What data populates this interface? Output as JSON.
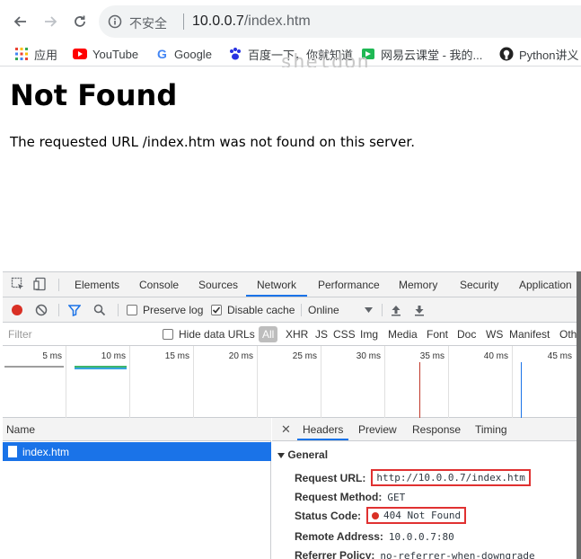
{
  "browser": {
    "omnibox": {
      "security_label": "不安全",
      "host": "10.0.0.7",
      "path": "/index.htm"
    },
    "bookmarks": [
      {
        "label": "应用"
      },
      {
        "label": "YouTube"
      },
      {
        "label": "Google"
      },
      {
        "label": "百度一下，你就知道"
      },
      {
        "label": "网易云课堂 - 我的..."
      },
      {
        "label": "Python讲义"
      }
    ]
  },
  "watermark": "sheldon",
  "page": {
    "title": "Not Found",
    "message": "The requested URL /index.htm was not found on this server."
  },
  "devtools": {
    "tabs": [
      "Elements",
      "Console",
      "Sources",
      "Network",
      "Performance",
      "Memory",
      "Security",
      "Application"
    ],
    "active_tab": "Network",
    "toolbar": {
      "preserve_log": "Preserve log",
      "disable_cache": "Disable cache",
      "throttle": "Online"
    },
    "filter": {
      "placeholder": "Filter",
      "hide_data_urls": "Hide data URLs",
      "types": [
        "All",
        "XHR",
        "JS",
        "CSS",
        "Img",
        "Media",
        "Font",
        "Doc",
        "WS",
        "Manifest",
        "Oth"
      ]
    },
    "timeline_ticks": [
      "5 ms",
      "10 ms",
      "15 ms",
      "20 ms",
      "25 ms",
      "30 ms",
      "35 ms",
      "40 ms",
      "45 ms"
    ],
    "requests": {
      "column_name": "Name",
      "rows": [
        {
          "name": "index.htm"
        }
      ]
    },
    "detail": {
      "tabs": [
        "Headers",
        "Preview",
        "Response",
        "Timing"
      ],
      "active_tab": "Headers",
      "section": "General",
      "fields": [
        {
          "key": "Request URL:",
          "value": "http://10.0.0.7/index.htm"
        },
        {
          "key": "Request Method:",
          "value": "GET"
        },
        {
          "key": "Status Code:",
          "value": "404 Not Found"
        },
        {
          "key": "Remote Address:",
          "value": "10.0.0.7:80"
        },
        {
          "key": "Referrer Policy:",
          "value": "no-referrer-when-downgrade"
        }
      ]
    }
  },
  "colors": {
    "accent": "#1a73e8",
    "error": "#d93025",
    "highlight_box": "#e03131"
  }
}
